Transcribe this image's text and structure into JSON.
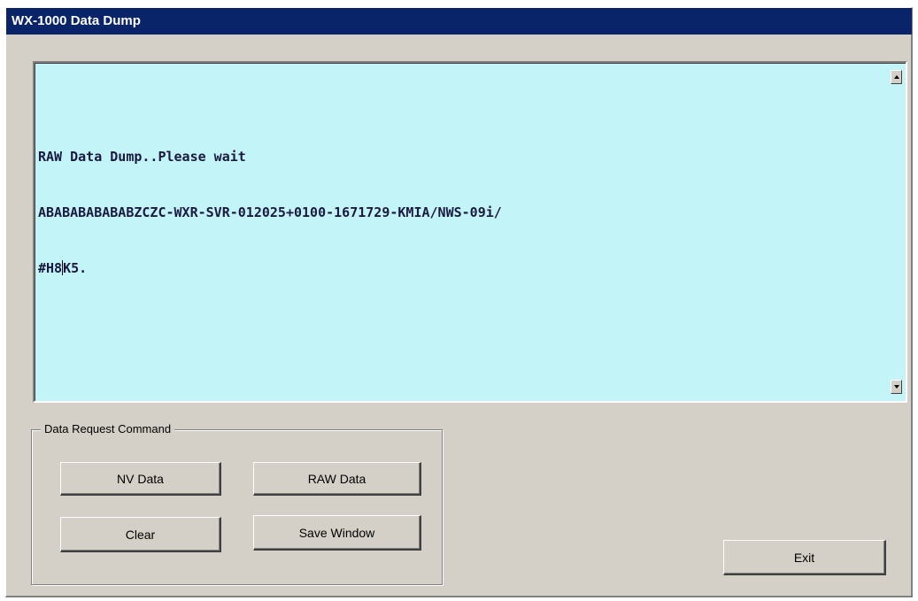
{
  "window": {
    "title": "WX-1000 Data Dump"
  },
  "output": {
    "lines": [
      "RAW Data Dump..Please wait",
      "ABABABABABABZCZC-WXR-SVR-012025+0100-1671729-KMIA/NWS-09i/",
      "#H8",
      "K5."
    ],
    "background_color": "#c3f4f8"
  },
  "group": {
    "legend": "Data Request Command",
    "nv_data_label": "NV Data",
    "raw_data_label": "RAW Data",
    "clear_label": "Clear",
    "save_window_label": "Save Window"
  },
  "exit_label": "Exit",
  "colors": {
    "titlebar": "#0a246a",
    "window_face": "#d4d0c8"
  },
  "icons": {
    "scroll_up": "scroll-up-arrow-icon",
    "scroll_down": "scroll-down-arrow-icon"
  }
}
